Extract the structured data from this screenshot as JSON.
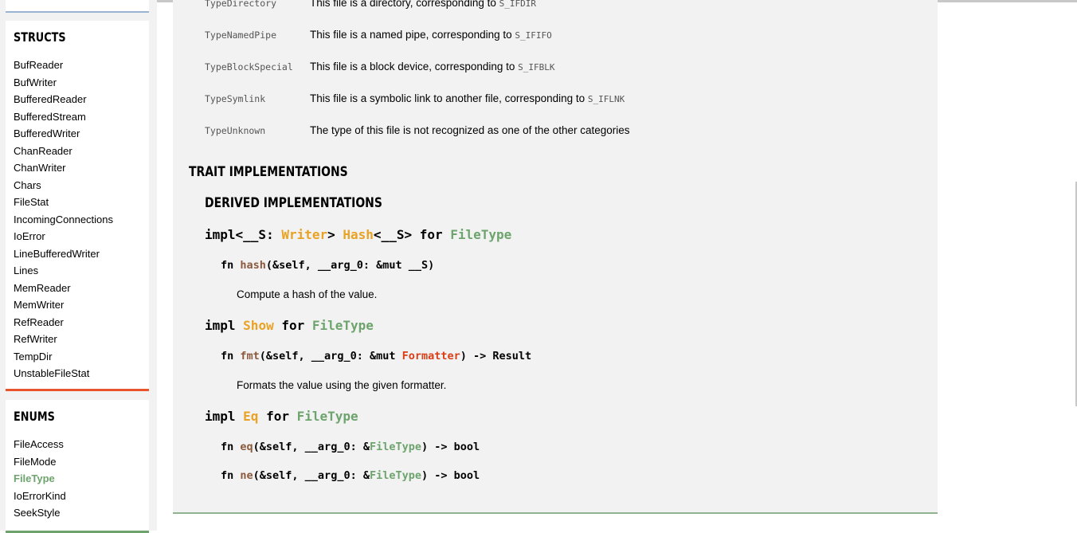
{
  "sidebar": {
    "structs_title": "STRUCTS",
    "structs": [
      "BufReader",
      "BufWriter",
      "BufferedReader",
      "BufferedStream",
      "BufferedWriter",
      "ChanReader",
      "ChanWriter",
      "Chars",
      "FileStat",
      "IncomingConnections",
      "IoError",
      "LineBufferedWriter",
      "Lines",
      "MemReader",
      "MemWriter",
      "RefReader",
      "RefWriter",
      "TempDir",
      "UnstableFileStat"
    ],
    "enums_title": "ENUMS",
    "enums": [
      "FileAccess",
      "FileMode",
      "FileType",
      "IoErrorKind",
      "SeekStyle"
    ],
    "active_enum": "FileType"
  },
  "variants": [
    {
      "name": "TypeDirectory",
      "desc": "This file is a directory, corresponding to ",
      "code": "S_IFDIR"
    },
    {
      "name": "TypeNamedPipe",
      "desc": "This file is a named pipe, corresponding to ",
      "code": "S_IFIFO"
    },
    {
      "name": "TypeBlockSpecial",
      "desc": "This file is a block device, corresponding to ",
      "code": "S_IFBLK"
    },
    {
      "name": "TypeSymlink",
      "desc": "This file is a symbolic link to another file, corresponding to ",
      "code": "S_IFLNK"
    },
    {
      "name": "TypeUnknown",
      "desc": "The type of this file is not recognized as one of the other categories",
      "code": ""
    }
  ],
  "headings": {
    "trait_impls": "TRAIT IMPLEMENTATIONS",
    "derived_impls": "DERIVED IMPLEMENTATIONS"
  },
  "impls": {
    "hash": {
      "kw_impl": "impl<__S: ",
      "trait_writer": "Writer",
      "gt": "> ",
      "trait": "Hash",
      "generic": "<__S> for ",
      "type": "FileType",
      "fn_kw": "fn ",
      "fn_name": "hash",
      "fn_sig": "(&self, __arg_0: &mut __S)",
      "doc": "Compute a hash of the value."
    },
    "show": {
      "kw_impl": "impl ",
      "trait": "Show",
      "kw_for": " for ",
      "type": "FileType",
      "fn_kw": "fn ",
      "fn_name": "fmt",
      "fn_sig1": "(&self, __arg_0: &mut ",
      "fn_struct": "Formatter",
      "fn_sig2": ") -> Result",
      "doc": "Formats the value using the given formatter."
    },
    "eq": {
      "kw_impl": "impl ",
      "trait": "Eq",
      "kw_for": " for ",
      "type": "FileType",
      "fn_kw": "fn ",
      "eq_name": "eq",
      "ne_name": "ne",
      "sig1": "(&self, __arg_0: &",
      "sig_type": "FileType",
      "sig2": ") -> bool"
    }
  },
  "colors": {
    "trait": "#e9a223",
    "type": "#6da46d",
    "struct": "#d93f17",
    "structs_border": "#e8552d",
    "enums_border": "#6da46d"
  }
}
